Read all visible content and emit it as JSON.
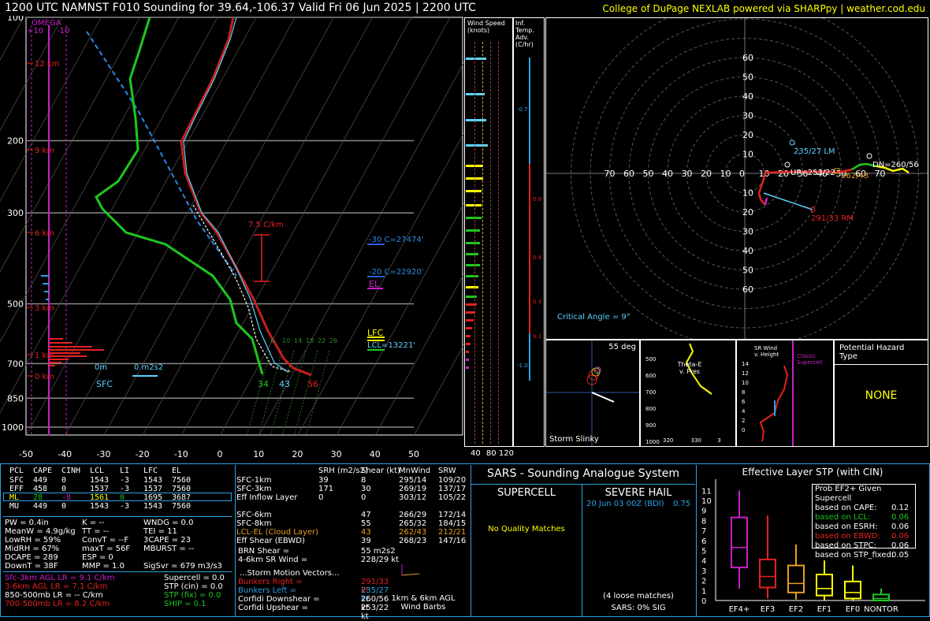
{
  "header": {
    "title": "1200 UTC NAMNST F010 Sounding for 39.64,-106.37 Valid  Fri 06 Jun 2025 | 2200 UTC",
    "credit": "College of DuPage NEXLAB powered via SHARPpy | weather.cod.edu"
  },
  "colors": {
    "bg": "#000000",
    "temp": "#c81e1e",
    "dew": "#1ec81e",
    "wetbulb": "#5ad2ff",
    "parcel": "#ffffff",
    "accent": "#ffff00",
    "border": "#2aa2e6"
  },
  "chart_data": [
    {
      "type": "line",
      "name": "skewt",
      "title": "",
      "ylabel_ticks": [
        "100",
        "200",
        "300",
        "500",
        "700",
        "850",
        "1000"
      ],
      "pressure_levels": [
        100,
        200,
        300,
        500,
        700,
        850,
        1000
      ],
      "x_ticks": [
        "-50",
        "-40",
        "-30",
        "-20",
        "-10",
        "0",
        "10",
        "20",
        "30",
        "40",
        "50"
      ],
      "x_values": [
        -50,
        -40,
        -30,
        -20,
        -10,
        0,
        10,
        20,
        30,
        40,
        50
      ],
      "height_labels": [
        "12 km",
        "9 km",
        "6 km",
        "3 km",
        "1 km",
        "0 km"
      ],
      "omega_label": "OMEGA",
      "omega_ticks": [
        "+10",
        "-10"
      ],
      "lapse_label": "7.5 C/km",
      "hgz_labels": [
        "-30 C=27474'",
        "-20 C=22920'"
      ],
      "el_label": "EL",
      "lfc_label": "LFC",
      "lcl_label": "LCL=13221'",
      "sfc_label": "SFC",
      "srh_labels": [
        "0m",
        "0 m2s2"
      ],
      "surface_values": [
        "34",
        "43",
        "56"
      ],
      "mixing_ratio_labels": [
        "6",
        "10",
        "14",
        "18",
        "22",
        "26"
      ],
      "series": [
        {
          "name": "Temperature",
          "points": [
            [
              -60,
              100
            ],
            [
              -56,
              200
            ],
            [
              -44,
              300
            ],
            [
              -25,
              400
            ],
            [
              -8,
              500
            ],
            [
              -2,
              600
            ],
            [
              7,
              700
            ],
            [
              14,
              720
            ]
          ]
        },
        {
          "name": "Dewpoint",
          "points": [
            [
              -77,
              100
            ],
            [
              -70,
              200
            ],
            [
              -60,
              300
            ],
            [
              -41,
              400
            ],
            [
              -30,
              500
            ],
            [
              -15,
              600
            ],
            [
              -4,
              700
            ]
          ]
        },
        {
          "name": "Wetbulb",
          "points": [
            [
              -61,
              100
            ],
            [
              -57,
              200
            ],
            [
              -45,
              300
            ],
            [
              -26,
              400
            ],
            [
              -10,
              500
            ],
            [
              -5,
              600
            ],
            [
              2,
              700
            ],
            [
              7,
              720
            ]
          ]
        },
        {
          "name": "Parcel",
          "points": [
            [
              -38,
              300
            ],
            [
              -20,
              400
            ],
            [
              -6,
              500
            ],
            [
              1,
              600
            ],
            [
              10,
              700
            ],
            [
              14,
              720
            ]
          ]
        }
      ]
    },
    {
      "type": "scatter",
      "name": "hodograph",
      "axis_ticks": [
        "60",
        "50",
        "40",
        "30",
        "20",
        "10",
        "0",
        "10",
        "20",
        "30",
        "40",
        "50",
        "60",
        "70"
      ],
      "annotations": [
        "235/27 LM",
        "291/33 RM",
        "UP=253/22",
        "DN=260/56",
        "262/43"
      ],
      "critical_angle": "Critical Angle = 9°"
    }
  ],
  "wind_speed_panel": {
    "title": "Wind Speed (knots)",
    "ticks": [
      "40",
      "80",
      "120"
    ]
  },
  "inferred_panel": {
    "title": "Inf. Temp. Adv.(C/hr)",
    "values": [
      "-0.7",
      "0.9",
      "0.4",
      "0.3",
      "0.1",
      "-1.0"
    ]
  },
  "small_panels": {
    "storm_slinky": {
      "label": "Storm Slinky",
      "angle": "55 deg"
    },
    "theta": {
      "label": "Theta-E v. Pres",
      "ticks": [
        "500",
        "600",
        "700",
        "800",
        "900",
        "1000"
      ],
      "xticks": [
        "320",
        "330",
        "3"
      ]
    },
    "srwind": {
      "label": "SR Wind v. Height",
      "ticks": [
        "14",
        "12",
        "10",
        "8",
        "6",
        "4",
        "2",
        "0"
      ],
      "note": "Classic Supercell"
    },
    "hazard": {
      "title": "Potential Hazard Type",
      "value": "NONE"
    }
  },
  "parcels": {
    "headers": [
      "PCL",
      "CAPE",
      "CINH",
      "LCL",
      "LI",
      "LFC",
      "EL"
    ],
    "rows": [
      [
        "SFC",
        "449",
        "0",
        "1543",
        "-3",
        "1543",
        "7560"
      ],
      [
        "EFF",
        "458",
        "0",
        "1537",
        "-3",
        "1537",
        "7560"
      ],
      [
        "ML",
        "28",
        "-8",
        "1561",
        "0",
        "1695",
        "3687"
      ],
      [
        "MU",
        "449",
        "0",
        "1543",
        "-3",
        "1543",
        "7560"
      ]
    ]
  },
  "indices": [
    [
      "PW = 0.4in",
      "K = --",
      "WNDG = 0.0"
    ],
    [
      "MeanW = 4.9g/kg",
      "TT = --",
      "TEI = 11"
    ],
    [
      "LowRH = 59%",
      "ConvT = --F",
      "3CAPE = 23"
    ],
    [
      "MidRH = 67%",
      "maxT = 56F",
      "MBURST = --"
    ],
    [
      "DCAPE = 289",
      "ESP = 0",
      ""
    ],
    [
      "DownT = 38F",
      "MMP = 1.0",
      "SigSvr = 679 m3/s3"
    ]
  ],
  "lapse_rates": [
    "Sfc-3km AGL LR = 9.1 C/km",
    "3-6km AGL LR = 7.1 C/km",
    "850-500mb LR = -- C/km",
    "700-500mb LR = 8.2 C/km"
  ],
  "composite": [
    "Supercell = 0.0",
    "STP (cin) = 0.0",
    "STP (fix) = 0.0",
    "SHIP = 0.1"
  ],
  "kinematics": {
    "headers": [
      "",
      "SRH (m2/s2)",
      "Shear (kt)",
      "MnWind",
      "SRW"
    ],
    "rows": [
      [
        "SFC-1km",
        "39",
        "8",
        "295/14",
        "109/20"
      ],
      [
        "SFC-3km",
        "171",
        "30",
        "269/19",
        "137/17"
      ],
      [
        "Eff Inflow Layer",
        "0",
        "0",
        "303/12",
        "105/22"
      ],
      [
        "",
        "",
        "",
        "",
        ""
      ],
      [
        "SFC-6km",
        "",
        "47",
        "266/29",
        "172/14"
      ],
      [
        "SFC-8km",
        "",
        "55",
        "265/32",
        "184/15"
      ],
      [
        "LCL-EL (Cloud Layer)",
        "",
        "43",
        "262/43",
        "212/21"
      ],
      [
        "Eff Shear (EBWD)",
        "",
        "39",
        "268/23",
        "147/16"
      ]
    ],
    "brn_shear": "BRN Shear =",
    "brn_value": "55 m2s2",
    "srw_46": "4-6km SR Wind =",
    "srw_46_value": "228/29 kt",
    "storm_title": "...Storm Motion Vectors...",
    "storm": [
      [
        "Bunkers Right =",
        "291/33 kt"
      ],
      [
        "Bunkers Left =",
        "235/27 kt"
      ],
      [
        "Corfidi Downshear =",
        "260/56 kt"
      ],
      [
        "Corfidi Upshear =",
        "253/22 kt"
      ]
    ],
    "barbs_caption": "1km & 6km AGL Wind Barbs"
  },
  "sars": {
    "title": "SARS - Sounding Analogue System",
    "supercell": "SUPERCELL",
    "severe_hail": "SEVERE HAIL",
    "supercell_msg": "No Quality Matches",
    "hail_match": "20 Jun 03 00Z (BDI)",
    "hail_match_val": "0.75",
    "loose": "(4 loose matches)",
    "sig": "SARS: 0% SIG"
  },
  "stp": {
    "title": "Effective Layer STP (with CIN)",
    "y_ticks": [
      "11",
      "10",
      "9",
      "8",
      "7",
      "6",
      "5",
      "4",
      "3",
      "2",
      "1",
      "0"
    ],
    "categories": [
      "EF4+",
      "EF3",
      "EF2",
      "EF1",
      "EF0",
      "NONTOR"
    ],
    "legend_title": "Prob EF2+ Given Supercell",
    "probs": [
      [
        "based on CAPE:",
        "0.12"
      ],
      [
        "based on LCL:",
        "0.06"
      ],
      [
        "based on ESRH:",
        "0.06"
      ],
      [
        "based on EBWD:",
        "0.06"
      ],
      [
        "based on STPC:",
        "0.06"
      ],
      [
        "based on STP_fixed:",
        "0.05"
      ]
    ]
  }
}
